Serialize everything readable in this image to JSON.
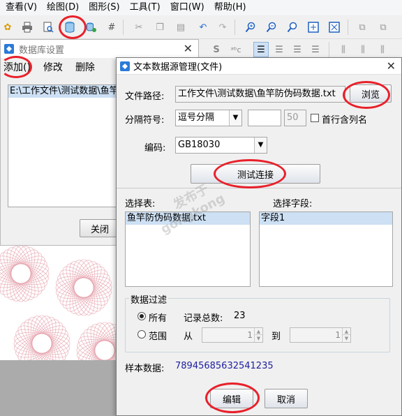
{
  "menubar": {
    "items": [
      "查看(V)",
      "绘图(D)",
      "图形(S)",
      "工具(T)",
      "窗口(W)",
      "帮助(H)"
    ]
  },
  "toolbar2": {
    "font_glyph_s": "S",
    "font_glyph_abc": "ᵃᵇc"
  },
  "db_dialog": {
    "title": "数据库设置",
    "close_glyph": "✕",
    "actions": {
      "add": "添加()",
      "edit": "修改",
      "delete": "删除"
    },
    "connections": [
      "E:\\工作文件\\测试数据\\鱼竿防伪码数据.txt"
    ],
    "close_button": "关闭"
  },
  "ds_dialog": {
    "title": "文本数据源管理(文件)",
    "close_glyph": "✕",
    "file_path_label": "文件路径:",
    "file_path_value": "工作文件\\测试数据\\鱼竿防伪码数据.txt",
    "browse_button": "浏览",
    "separator_label": "分隔符号:",
    "separator_value": "逗号分隔",
    "separator_custom": "",
    "separator_length": "50",
    "header_checkbox_label": "首行含列名",
    "encoding_label": "编码:",
    "encoding_value": "GB18030",
    "test_button": "测试连接",
    "table_label": "选择表:",
    "tables": [
      "鱼竿防伪码数据.txt"
    ],
    "field_label": "选择字段:",
    "fields": [
      "字段1"
    ],
    "filter": {
      "legend": "数据过滤",
      "all_label": "所有",
      "total_label": "记录总数:",
      "total_value": "23",
      "range_label": "范围",
      "from_label": "从",
      "from_value": "1",
      "to_label": "到",
      "to_value": "1"
    },
    "sample_label": "样本数据:",
    "sample_value": "78945685632541235",
    "edit_button": "编辑",
    "cancel_button": "取消"
  },
  "watermark": {
    "line1": "发布于",
    "line2": "gongkong"
  },
  "colors": {
    "annotation": "#e8202a",
    "selection": "#cde0f4",
    "sample_text": "#2020a0"
  }
}
